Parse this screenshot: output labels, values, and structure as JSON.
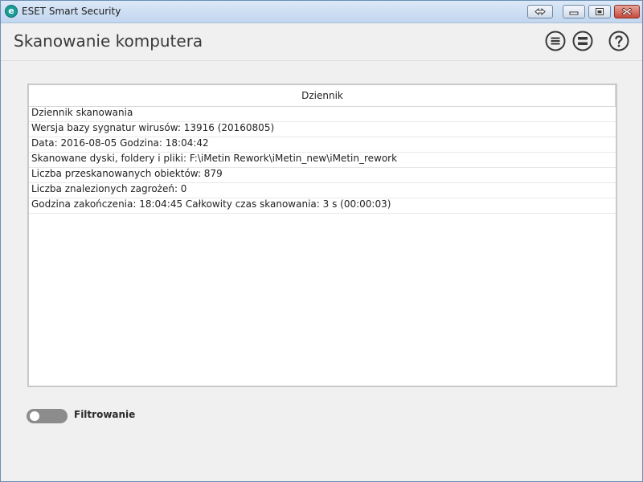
{
  "window": {
    "title": "ESET Smart Security",
    "logo_letter": "e",
    "buttons": [
      "resize-arrows-icon",
      "minimize-icon",
      "maximize-icon",
      "close-icon"
    ]
  },
  "header": {
    "title": "Skanowanie komputera",
    "icons": [
      "list-menu-icon",
      "details-menu-icon",
      "help-icon"
    ],
    "icon_color": "#3a3a3a"
  },
  "log": {
    "column_header": "Dziennik",
    "rows": [
      "Dziennik skanowania",
      "Wersja bazy sygnatur wirusów: 13916 (20160805)",
      "Data: 2016-08-05  Godzina: 18:04:42",
      "Skanowane dyski, foldery i pliki: F:\\iMetin Rework\\iMetin_new\\iMetin_rework",
      "Liczba przeskanowanych obiektów: 879",
      "Liczba znalezionych zagrożeń: 0",
      "Godzina zakończenia: 18:04:45  Całkowity czas skanowania: 3 s (00:00:03)"
    ]
  },
  "filter": {
    "label": "Filtrowanie",
    "enabled": false
  },
  "colors": {
    "brand": "#1a9c97",
    "toggle_off": "#8c8c8c"
  }
}
